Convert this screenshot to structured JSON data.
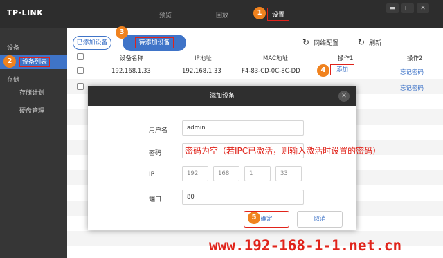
{
  "titlebar": {
    "logo": "TP-LINK",
    "tabs": [
      "预览",
      "回放",
      "设置"
    ],
    "window_controls": [
      "▬",
      "▢",
      "✕"
    ]
  },
  "sidebar": {
    "group_device": "设备",
    "item_device_list": "设备列表",
    "group_storage": "存储",
    "item_storage_plan": "存储计划",
    "item_disk_mgmt": "硬盘管理"
  },
  "toolbar": {
    "added_devices": "已添加设备",
    "pending_devices": "待添加设备",
    "network_config": "网络配置",
    "refresh": "刷新"
  },
  "table": {
    "headers": [
      "设备名称",
      "IP地址",
      "MAC地址",
      "操作1",
      "操作2"
    ],
    "rows": [
      {
        "name": "192.168.1.33",
        "ip": "192.168.1.33",
        "mac": "F4-83-CD-0C-8C-DD",
        "op1": "添加",
        "op2": "忘记密码"
      },
      {
        "name": "",
        "ip": "",
        "mac": "",
        "op1": "",
        "op2": "忘记密码"
      }
    ]
  },
  "dialog": {
    "title": "添加设备",
    "close": "✕",
    "username_label": "用户名",
    "username_value": "admin",
    "password_label": "密码",
    "password_hint": "密码为空（若IPC已激活，则输入激活时设置的密码）",
    "ip_label": "IP",
    "ip_parts": [
      "192",
      "168",
      "1",
      "33"
    ],
    "port_label": "端口",
    "port_value": "80",
    "ok": "确定",
    "cancel": "取消"
  },
  "steps": [
    "1",
    "2",
    "3",
    "4",
    "5"
  ],
  "watermark": "www.192-168-1-1.net.cn",
  "colors": {
    "accent": "#3f74c8",
    "highlight_box": "#e0231a",
    "step_marker": "#f0821e"
  }
}
